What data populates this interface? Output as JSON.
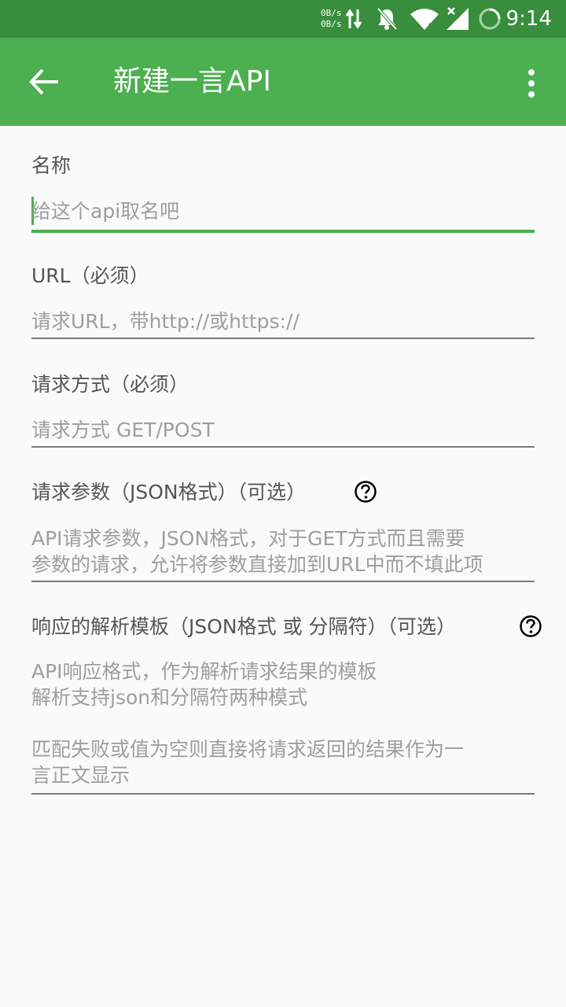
{
  "status": {
    "net_up": "0B/s",
    "net_down": "0B/s",
    "time": "9:14"
  },
  "appbar": {
    "title": "新建一言API",
    "back_icon": "arrow-left-icon",
    "more_icon": "more-vert-icon"
  },
  "fields": {
    "name": {
      "label": "名称",
      "placeholder": "给这个api取名吧"
    },
    "url": {
      "label": "URL（必须）",
      "placeholder": "请求URL，带http://或https://"
    },
    "method": {
      "label": "请求方式（必须）",
      "placeholder": "请求方式 GET/POST"
    },
    "params": {
      "label": "请求参数（JSON格式）（可选）",
      "placeholder_l1": "API请求参数，JSON格式，对于GET方式而且需要",
      "placeholder_l2": "参数的请求，允许将参数直接加到URL中而不填此项"
    },
    "template": {
      "label": "响应的解析模板（JSON格式 或 分隔符）（可选）",
      "placeholder_l1": "API响应格式，作为解析请求结果的模板",
      "placeholder_l2": "解析支持json和分隔符两种模式",
      "placeholder_l3": "匹配失败或值为空则直接将请求返回的结果作为一",
      "placeholder_l4": "言正文显示"
    }
  },
  "colors": {
    "primary": "#4caf50",
    "primary_dark": "#388e3c"
  }
}
